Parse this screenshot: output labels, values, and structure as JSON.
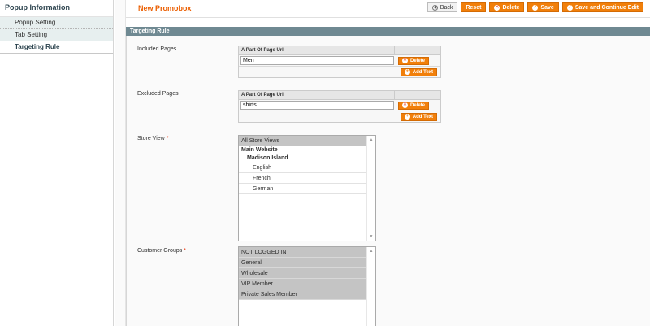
{
  "sidebar": {
    "title": "Popup Information",
    "tabs": [
      {
        "label": "Popup Setting"
      },
      {
        "label": "Tab Setting"
      },
      {
        "label": "Targeting Rule"
      }
    ]
  },
  "header": {
    "title": "New Promobox",
    "buttons": {
      "back": "Back",
      "reset": "Reset",
      "delete": "Delete",
      "save": "Save",
      "save_continue": "Save and Continue Edit"
    }
  },
  "section": {
    "title": "Targeting Rule"
  },
  "included_pages": {
    "label": "Included Pages",
    "column_header": "A Part Of Page Url",
    "value": "Men",
    "delete_label": "Delete",
    "add_label": "Add Text"
  },
  "excluded_pages": {
    "label": "Excluded Pages",
    "column_header": "A Part Of Page Url",
    "value": "shirts",
    "delete_label": "Delete",
    "add_label": "Add Text"
  },
  "store_view": {
    "label": "Store View",
    "required_mark": "*",
    "options": {
      "all": "All Store Views",
      "website": "Main Website",
      "store": "Madison Island",
      "english": "English",
      "french": "French",
      "german": "German"
    }
  },
  "customer_groups": {
    "label": "Customer Groups",
    "required_mark": "*",
    "options": [
      {
        "label": "NOT LOGGED IN",
        "selected": true
      },
      {
        "label": "General",
        "selected": true
      },
      {
        "label": "Wholesale",
        "selected": true
      },
      {
        "label": "VIP Member",
        "selected": true
      },
      {
        "label": "Private Sales Member",
        "selected": true
      }
    ]
  },
  "colors": {
    "accent": "#eb5e00",
    "button": "#f17f0a",
    "section_header": "#6f8992",
    "tab_bg": "#e7efef",
    "selected_option": "#c4c4c4"
  }
}
